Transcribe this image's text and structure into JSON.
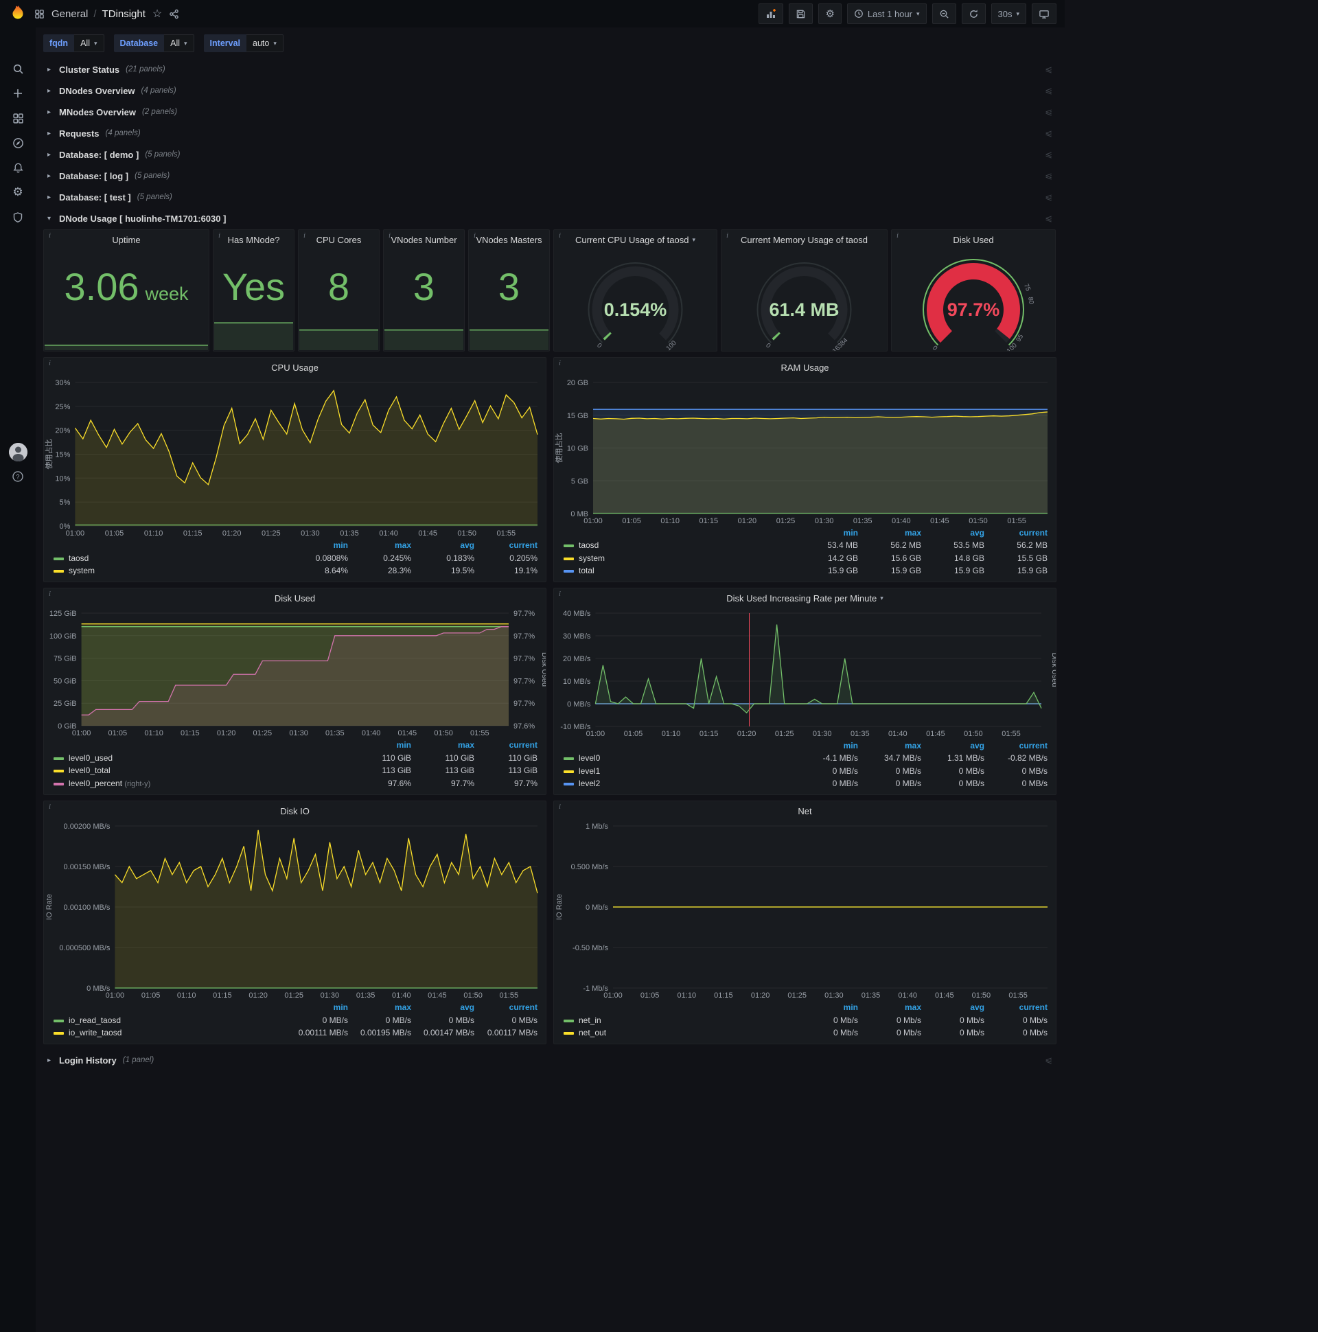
{
  "app": {
    "breadcrumb": {
      "section": "General",
      "separator": "/",
      "title": "TDinsight"
    },
    "toolbar": {
      "time_range": "Last 1 hour",
      "refresh_interval": "30s"
    }
  },
  "variables": [
    {
      "label": "fqdn",
      "value": "All"
    },
    {
      "label": "Database",
      "value": "All"
    },
    {
      "label": "Interval",
      "value": "auto"
    }
  ],
  "rows_top": [
    {
      "title": "Cluster Status",
      "count": "(21 panels)"
    },
    {
      "title": "DNodes Overview",
      "count": "(4 panels)"
    },
    {
      "title": "MNodes Overview",
      "count": "(2 panels)"
    },
    {
      "title": "Requests",
      "count": "(4 panels)"
    },
    {
      "title": "Database: [ demo ]",
      "count": "(5 panels)"
    },
    {
      "title": "Database: [ log ]",
      "count": "(5 panels)"
    },
    {
      "title": "Database: [ test ]",
      "count": "(5 panels)"
    }
  ],
  "dnode_row": {
    "title": "DNode Usage [ huolinhe-TM1701:6030 ]"
  },
  "rows_bottom": [
    {
      "title": "Login History",
      "count": "(1 panel)"
    }
  ],
  "stats": [
    {
      "title": "Uptime",
      "value": "3.06",
      "unit": "week",
      "spark": 0.05
    },
    {
      "title": "Has MNode?",
      "value": "Yes",
      "spark": 0.27
    },
    {
      "title": "CPU Cores",
      "value": "8",
      "spark": 0.2
    },
    {
      "title": "VNodes Number",
      "value": "3",
      "spark": 0.2
    },
    {
      "title": "VNodes Masters",
      "value": "3",
      "spark": 0.2
    }
  ],
  "gauges": [
    {
      "id": "cpu",
      "title": "Current CPU Usage of taosd",
      "value": "0.154%",
      "frac": 0.0015,
      "thick": 14,
      "color": "#73bf69",
      "rest": "#23262b",
      "ring": "#2c3235",
      "value_color": "#b7dfb1",
      "labels": [
        {
          "t": "0",
          "f": 0
        },
        {
          "t": "100",
          "f": 1
        }
      ]
    },
    {
      "id": "mem",
      "title": "Current Memory Usage of taosd",
      "value": "61.4 MB",
      "frac": 0.0037,
      "thick": 14,
      "color": "#73bf69",
      "rest": "#23262b",
      "ring": "#2c3235",
      "value_color": "#b7dfb1",
      "labels": [
        {
          "t": "0",
          "f": 0
        },
        {
          "t": "16384",
          "f": 1
        }
      ]
    },
    {
      "id": "disk",
      "title": "Disk Used",
      "value": "97.7%",
      "frac": 0.977,
      "thick": 24,
      "color": "#e02f44",
      "rest": "#22252a",
      "ring": "#73bf69",
      "value_color": "#f2495c",
      "labels": [
        {
          "t": "0",
          "f": 0
        },
        {
          "t": "75",
          "f": 0.75
        },
        {
          "t": "80",
          "f": 0.8
        },
        {
          "t": "95",
          "f": 0.95
        },
        {
          "t": "100",
          "f": 1
        }
      ]
    }
  ],
  "x_ticks": [
    "01:00",
    "01:05",
    "01:10",
    "01:15",
    "01:20",
    "01:25",
    "01:30",
    "01:35",
    "01:40",
    "01:45",
    "01:50",
    "01:55"
  ],
  "charts": [
    {
      "id": "cpu-usage",
      "type": "line",
      "title": "CPU Usage",
      "y_label": "使用占比",
      "ylim": [
        0,
        30
      ],
      "y_ticks": [
        {
          "v": 0,
          "t": "0%"
        },
        {
          "v": 5,
          "t": "5%"
        },
        {
          "v": 10,
          "t": "10%"
        },
        {
          "v": 15,
          "t": "15%"
        },
        {
          "v": 20,
          "t": "20%"
        },
        {
          "v": 25,
          "t": "25%"
        },
        {
          "v": 30,
          "t": "30%"
        }
      ],
      "series": [
        {
          "name": "system",
          "color": "#fade2a",
          "fill": true,
          "values": [
            20.5,
            18.2,
            22.1,
            19.0,
            16.4,
            20.2,
            17.1,
            19.6,
            21.4,
            18.0,
            16.2,
            19.3,
            15.5,
            10.4,
            9.0,
            13.2,
            10.1,
            8.64,
            14.3,
            21.0,
            24.6,
            17.2,
            19.1,
            22.4,
            18.1,
            24.2,
            21.6,
            19.2,
            25.6,
            20.1,
            17.4,
            22.3,
            26.1,
            28.3,
            21.2,
            19.4,
            23.6,
            26.4,
            21.1,
            19.5,
            24.2,
            27.0,
            22.1,
            20.3,
            23.2,
            19.2,
            17.6,
            21.4,
            24.6,
            20.2,
            23.1,
            26.2,
            21.6,
            25.1,
            22.4,
            27.4,
            25.8,
            22.6,
            24.8,
            19.1
          ]
        },
        {
          "name": "taosd",
          "color": "#73bf69",
          "fill": false,
          "values": [
            0.2,
            0.2
          ]
        }
      ],
      "legend": {
        "cols": [
          "min",
          "max",
          "avg",
          "current"
        ],
        "rows": [
          {
            "name": "taosd",
            "color": "#73bf69",
            "vals": [
              "0.0808%",
              "0.245%",
              "0.183%",
              "0.205%"
            ]
          },
          {
            "name": "system",
            "color": "#fade2a",
            "vals": [
              "8.64%",
              "28.3%",
              "19.5%",
              "19.1%"
            ]
          }
        ]
      }
    },
    {
      "id": "ram-usage",
      "type": "line",
      "title": "RAM Usage",
      "y_label": "使用占比",
      "ylim": [
        0,
        20
      ],
      "y_ticks": [
        {
          "v": 0,
          "t": "0 MB"
        },
        {
          "v": 5,
          "t": "5 GB"
        },
        {
          "v": 10,
          "t": "10 GB"
        },
        {
          "v": 15,
          "t": "15 GB"
        },
        {
          "v": 20,
          "t": "20 GB"
        }
      ],
      "series": [
        {
          "name": "total",
          "color": "#5794f2",
          "fill": true,
          "values": [
            15.9,
            15.9
          ]
        },
        {
          "name": "system",
          "color": "#fade2a",
          "fill": true,
          "values": [
            14.5,
            14.42,
            14.5,
            14.46,
            14.4,
            14.52,
            14.56,
            14.46,
            14.5,
            14.42,
            14.5,
            14.46,
            14.52,
            14.56,
            14.5,
            14.46,
            14.5,
            14.42,
            14.5,
            14.5,
            14.46,
            14.56,
            14.5,
            14.46,
            14.5,
            14.56,
            14.6,
            14.5,
            14.56,
            14.6,
            14.7,
            14.62,
            14.66,
            14.7,
            14.62,
            14.66,
            14.7,
            14.76,
            14.7,
            14.66,
            14.7,
            14.76,
            14.8,
            14.76,
            14.7,
            14.76,
            14.8,
            14.86,
            14.8,
            14.76,
            14.8,
            14.86,
            14.9,
            14.86,
            14.9,
            15.0,
            15.1,
            15.2,
            15.4,
            15.5
          ]
        },
        {
          "name": "taosd",
          "color": "#73bf69",
          "fill": false,
          "values": [
            0.056,
            0.056
          ]
        }
      ],
      "legend": {
        "cols": [
          "min",
          "max",
          "avg",
          "current"
        ],
        "rows": [
          {
            "name": "taosd",
            "color": "#73bf69",
            "vals": [
              "53.4 MB",
              "56.2 MB",
              "53.5 MB",
              "56.2 MB"
            ]
          },
          {
            "name": "system",
            "color": "#fade2a",
            "vals": [
              "14.2 GB",
              "15.6 GB",
              "14.8 GB",
              "15.5 GB"
            ]
          },
          {
            "name": "total",
            "color": "#5794f2",
            "vals": [
              "15.9 GB",
              "15.9 GB",
              "15.9 GB",
              "15.9 GB"
            ]
          }
        ]
      }
    },
    {
      "id": "disk-used",
      "type": "line",
      "title": "Disk Used",
      "ylim": [
        0,
        125
      ],
      "right_lim": [
        97.6,
        97.725
      ],
      "right_label": "Disk Used",
      "y_ticks": [
        {
          "v": 0,
          "t": "0 GiB"
        },
        {
          "v": 25,
          "t": "25 GiB"
        },
        {
          "v": 50,
          "t": "50 GiB"
        },
        {
          "v": 75,
          "t": "75 GiB"
        },
        {
          "v": 100,
          "t": "100 GiB"
        },
        {
          "v": 125,
          "t": "125 GiB"
        }
      ],
      "right_ticks": [
        {
          "t": "97.6%"
        },
        {
          "t": "97.7%"
        },
        {
          "t": "97.7%"
        },
        {
          "t": "97.7%"
        },
        {
          "t": "97.7%"
        },
        {
          "t": "97.7%"
        }
      ],
      "series": [
        {
          "name": "level0_total",
          "color": "#fade2a",
          "fill": true,
          "values": [
            113,
            113
          ]
        },
        {
          "name": "level0_used",
          "color": "#73bf69",
          "fill": true,
          "values": [
            110,
            110
          ]
        },
        {
          "name": "level0_percent",
          "color": "#d373ad",
          "fill": true,
          "axis": "right",
          "values": [
            97.612,
            97.612,
            97.618,
            97.618,
            97.618,
            97.618,
            97.618,
            97.618,
            97.627,
            97.627,
            97.627,
            97.627,
            97.627,
            97.645,
            97.645,
            97.645,
            97.645,
            97.645,
            97.645,
            97.645,
            97.645,
            97.657,
            97.657,
            97.657,
            97.657,
            97.672,
            97.672,
            97.672,
            97.672,
            97.672,
            97.672,
            97.672,
            97.672,
            97.672,
            97.672,
            97.7,
            97.7,
            97.7,
            97.7,
            97.7,
            97.7,
            97.7,
            97.7,
            97.7,
            97.7,
            97.7,
            97.7,
            97.7,
            97.7,
            97.7,
            97.703,
            97.703,
            97.703,
            97.703,
            97.703,
            97.703,
            97.707,
            97.707,
            97.71,
            97.71
          ]
        }
      ],
      "legend": {
        "cols": [
          "min",
          "max",
          "current"
        ],
        "rows": [
          {
            "name": "level0_used",
            "color": "#73bf69",
            "vals": [
              "110 GiB",
              "110 GiB",
              "110 GiB"
            ]
          },
          {
            "name": "level0_total",
            "color": "#fade2a",
            "vals": [
              "113 GiB",
              "113 GiB",
              "113 GiB"
            ]
          },
          {
            "name": "level0_percent",
            "note": "(right-y)",
            "color": "#d373ad",
            "vals": [
              "97.6%",
              "97.7%",
              "97.7%"
            ]
          }
        ]
      }
    },
    {
      "id": "disk-rate",
      "type": "line",
      "title": "Disk Used Increasing Rate per Minute",
      "caret": true,
      "ylim": [
        -10,
        40
      ],
      "right_label": "Disk Used",
      "annotation_x": 0.345,
      "y_ticks": [
        {
          "v": -10,
          "t": "-10 MB/s"
        },
        {
          "v": 0,
          "t": "0 MB/s"
        },
        {
          "v": 10,
          "t": "10 MB/s"
        },
        {
          "v": 20,
          "t": "20 MB/s"
        },
        {
          "v": 30,
          "t": "30 MB/s"
        },
        {
          "v": 40,
          "t": "40 MB/s"
        }
      ],
      "series": [
        {
          "name": "level1",
          "color": "#fade2a",
          "fill": false,
          "values": [
            0,
            0
          ]
        },
        {
          "name": "level2",
          "color": "#5794f2",
          "fill": false,
          "values": [
            0,
            0
          ]
        },
        {
          "name": "level0",
          "color": "#73bf69",
          "fill": true,
          "values": [
            0,
            17,
            1,
            0,
            3,
            0,
            0,
            11,
            0,
            0,
            0,
            0,
            0,
            -2,
            20,
            0,
            12,
            0,
            0,
            -1,
            -4,
            0,
            0,
            0,
            35,
            0,
            0,
            0,
            0,
            2,
            0,
            0,
            0,
            20,
            0,
            0,
            0,
            0,
            0,
            0,
            0,
            0,
            0,
            0,
            0,
            0,
            0,
            0,
            0,
            0,
            0,
            0,
            0,
            0,
            0,
            0,
            0,
            0,
            5,
            -2
          ]
        }
      ],
      "legend": {
        "cols": [
          "min",
          "max",
          "avg",
          "current"
        ],
        "rows": [
          {
            "name": "level0",
            "color": "#73bf69",
            "vals": [
              "-4.1 MB/s",
              "34.7 MB/s",
              "1.31 MB/s",
              "-0.82 MB/s"
            ]
          },
          {
            "name": "level1",
            "color": "#fade2a",
            "vals": [
              "0 MB/s",
              "0 MB/s",
              "0 MB/s",
              "0 MB/s"
            ]
          },
          {
            "name": "level2",
            "color": "#5794f2",
            "vals": [
              "0 MB/s",
              "0 MB/s",
              "0 MB/s",
              "0 MB/s"
            ]
          }
        ]
      }
    },
    {
      "id": "disk-io",
      "type": "line",
      "title": "Disk IO",
      "y_label": "IO Rate",
      "ylim": [
        0,
        0.002
      ],
      "y_ticks": [
        {
          "v": 0,
          "t": "0 MB/s"
        },
        {
          "v": 0.0005,
          "t": "0.000500 MB/s"
        },
        {
          "v": 0.001,
          "t": "0.00100 MB/s"
        },
        {
          "v": 0.0015,
          "t": "0.00150 MB/s"
        },
        {
          "v": 0.002,
          "t": "0.00200 MB/s"
        }
      ],
      "series": [
        {
          "name": "io_write_taosd",
          "color": "#fade2a",
          "fill": true,
          "values": [
            0.0014,
            0.0013,
            0.0015,
            0.00135,
            0.0014,
            0.00145,
            0.0013,
            0.0016,
            0.0014,
            0.00155,
            0.0013,
            0.00145,
            0.0015,
            0.00125,
            0.0014,
            0.0016,
            0.0013,
            0.0015,
            0.00175,
            0.0012,
            0.00195,
            0.0014,
            0.0012,
            0.0016,
            0.00135,
            0.00185,
            0.0013,
            0.00145,
            0.00165,
            0.0012,
            0.0018,
            0.00135,
            0.0015,
            0.00125,
            0.0017,
            0.0014,
            0.00155,
            0.0013,
            0.0016,
            0.00145,
            0.0012,
            0.00185,
            0.0014,
            0.00125,
            0.0015,
            0.00165,
            0.0013,
            0.00155,
            0.0014,
            0.0019,
            0.00135,
            0.0015,
            0.00125,
            0.0016,
            0.0014,
            0.00155,
            0.0013,
            0.00145,
            0.0015,
            0.00117
          ]
        },
        {
          "name": "io_read_taosd",
          "color": "#73bf69",
          "fill": false,
          "values": [
            0,
            0
          ]
        }
      ],
      "legend": {
        "cols": [
          "min",
          "max",
          "avg",
          "current"
        ],
        "rows": [
          {
            "name": "io_read_taosd",
            "color": "#73bf69",
            "vals": [
              "0 MB/s",
              "0 MB/s",
              "0 MB/s",
              "0 MB/s"
            ]
          },
          {
            "name": "io_write_taosd",
            "color": "#fade2a",
            "vals": [
              "0.00111 MB/s",
              "0.00195 MB/s",
              "0.00147 MB/s",
              "0.00117 MB/s"
            ]
          }
        ]
      }
    },
    {
      "id": "net",
      "type": "line",
      "title": "Net",
      "y_label": "IO Rate",
      "ylim": [
        -1,
        1
      ],
      "y_ticks": [
        {
          "v": -1,
          "t": "-1 Mb/s"
        },
        {
          "v": -0.5,
          "t": "-0.50 Mb/s"
        },
        {
          "v": 0,
          "t": "0 Mb/s"
        },
        {
          "v": 0.5,
          "t": "0.500 Mb/s"
        },
        {
          "v": 1,
          "t": "1 Mb/s"
        }
      ],
      "series": [
        {
          "name": "net_in",
          "color": "#73bf69",
          "fill": false,
          "values": [
            0,
            0
          ]
        },
        {
          "name": "net_out",
          "color": "#fade2a",
          "fill": false,
          "values": [
            0,
            0
          ]
        }
      ],
      "legend": {
        "cols": [
          "min",
          "max",
          "avg",
          "current"
        ],
        "rows": [
          {
            "name": "net_in",
            "color": "#73bf69",
            "vals": [
              "0 Mb/s",
              "0 Mb/s",
              "0 Mb/s",
              "0 Mb/s"
            ]
          },
          {
            "name": "net_out",
            "color": "#fade2a",
            "vals": [
              "0 Mb/s",
              "0 Mb/s",
              "0 Mb/s",
              "0 Mb/s"
            ]
          }
        ]
      }
    }
  ]
}
